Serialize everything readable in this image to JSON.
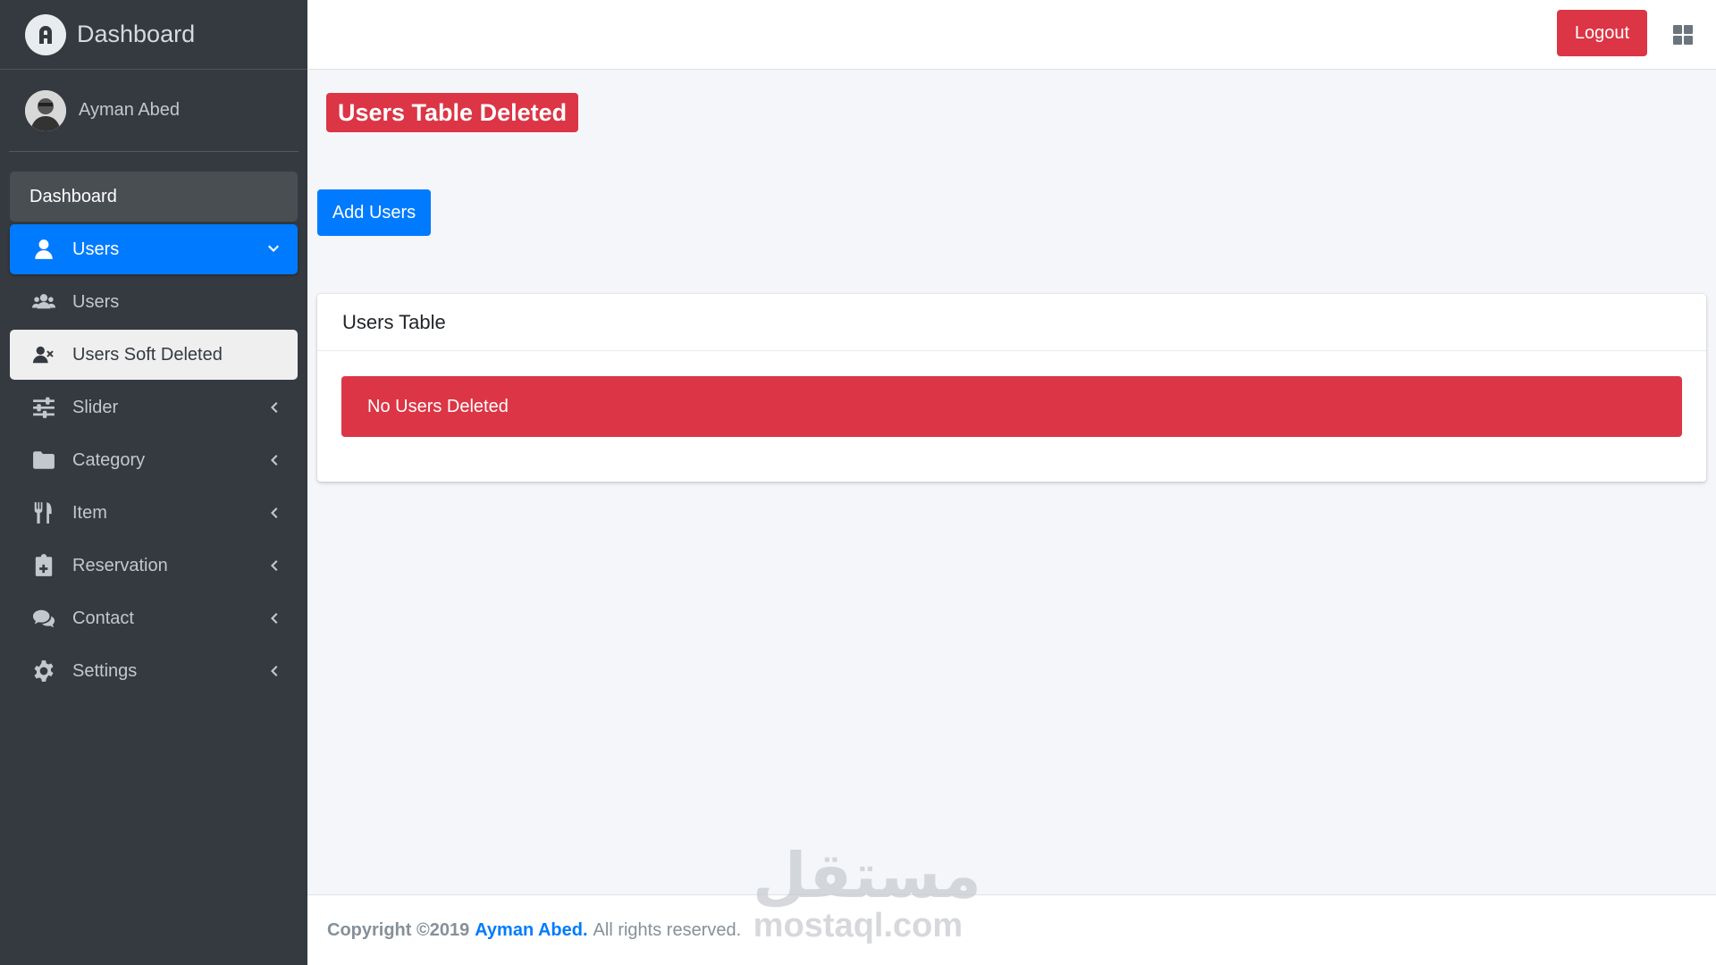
{
  "brand": {
    "title": "Dashboard"
  },
  "user": {
    "name": "Ayman Abed"
  },
  "sidebar": {
    "items": [
      {
        "label": "Dashboard",
        "icon": "none"
      },
      {
        "label": "Users",
        "icon": "user-icon",
        "expanded": true
      },
      {
        "label": "Users",
        "icon": "users-group-icon"
      },
      {
        "label": "Users Soft Deleted",
        "icon": "user-times-icon"
      },
      {
        "label": "Slider",
        "icon": "sliders-icon"
      },
      {
        "label": "Category",
        "icon": "folder-icon"
      },
      {
        "label": "Item",
        "icon": "utensils-icon"
      },
      {
        "label": "Reservation",
        "icon": "clipboard-plus-icon"
      },
      {
        "label": "Contact",
        "icon": "comments-icon"
      },
      {
        "label": "Settings",
        "icon": "gear-icon"
      }
    ]
  },
  "topbar": {
    "logout_label": "Logout"
  },
  "main": {
    "page_title": "Users Table Deleted",
    "add_button": "Add Users",
    "card_title": "Users Table",
    "alert_text": "No Users Deleted"
  },
  "footer": {
    "copyright": "Copyright ©2019",
    "author": "Ayman Abed.",
    "rights": "All rights reserved."
  },
  "watermark": {
    "arabic": "مستقل",
    "latin": "mostaql.com"
  },
  "colors": {
    "sidebar_bg": "#343a40",
    "primary": "#007bff",
    "danger": "#dc3545",
    "content_bg": "#f4f6f9"
  }
}
